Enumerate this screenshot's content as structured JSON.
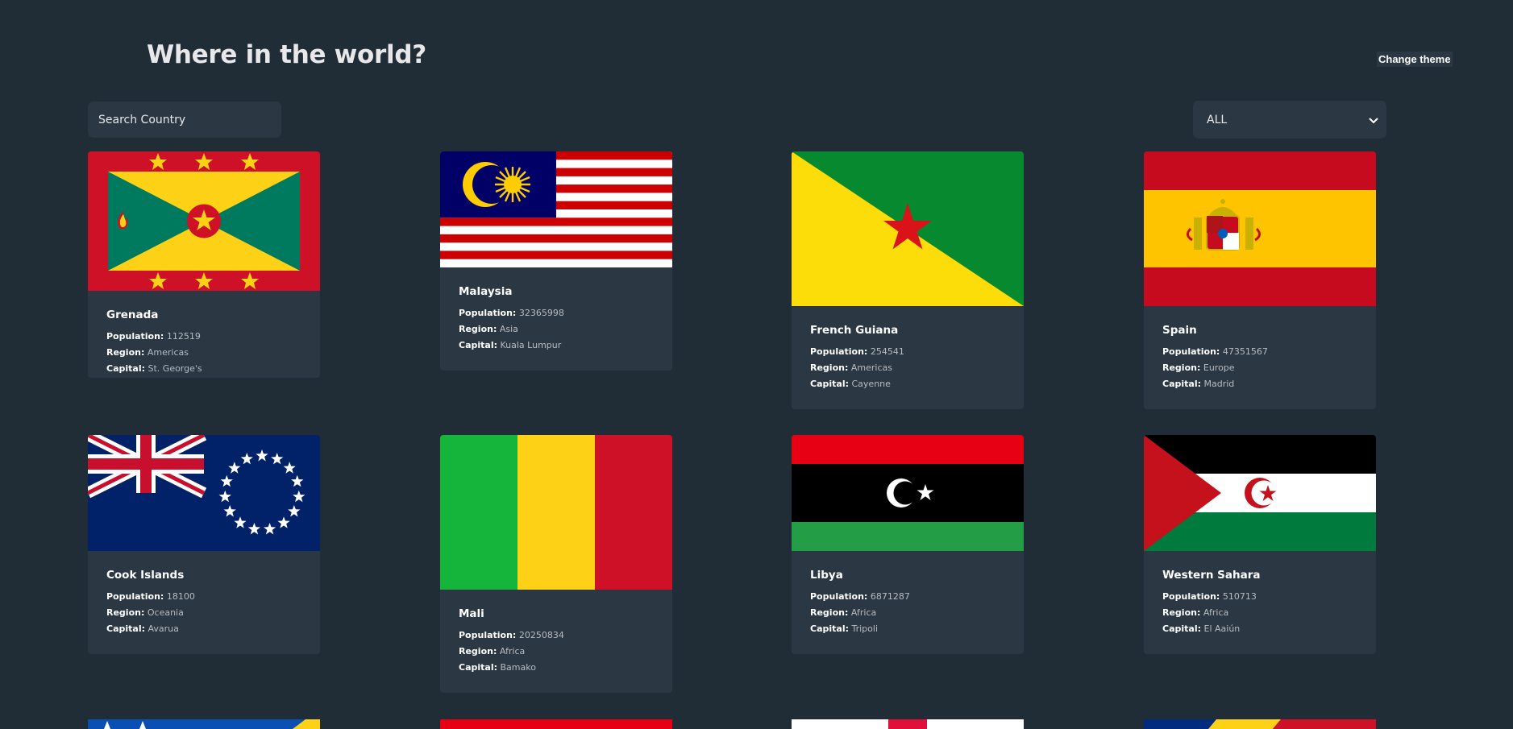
{
  "header": {
    "title": "Where in the world?",
    "theme_button": "Change theme"
  },
  "search": {
    "placeholder": "Search Country"
  },
  "filter": {
    "selected": "ALL"
  },
  "labels": {
    "population": "Population:",
    "region": "Region:",
    "capital": "Capital:"
  },
  "countries": [
    {
      "name": "Grenada",
      "population": "112519",
      "region": "Americas",
      "capital": "St. George's"
    },
    {
      "name": "Malaysia",
      "population": "32365998",
      "region": "Asia",
      "capital": "Kuala Lumpur"
    },
    {
      "name": "French Guiana",
      "population": "254541",
      "region": "Americas",
      "capital": "Cayenne"
    },
    {
      "name": "Spain",
      "population": "47351567",
      "region": "Europe",
      "capital": "Madrid"
    },
    {
      "name": "Cook Islands",
      "population": "18100",
      "region": "Oceania",
      "capital": "Avarua"
    },
    {
      "name": "Mali",
      "population": "20250834",
      "region": "Africa",
      "capital": "Bamako"
    },
    {
      "name": "Libya",
      "population": "6871287",
      "region": "Africa",
      "capital": "Tripoli"
    },
    {
      "name": "Western Sahara",
      "population": "510713",
      "region": "Africa",
      "capital": "El Aaiún"
    }
  ],
  "colors": {
    "background": "#202c36",
    "card": "#2b3743",
    "text": "#ffffff",
    "muted": "#b7bcc2"
  }
}
